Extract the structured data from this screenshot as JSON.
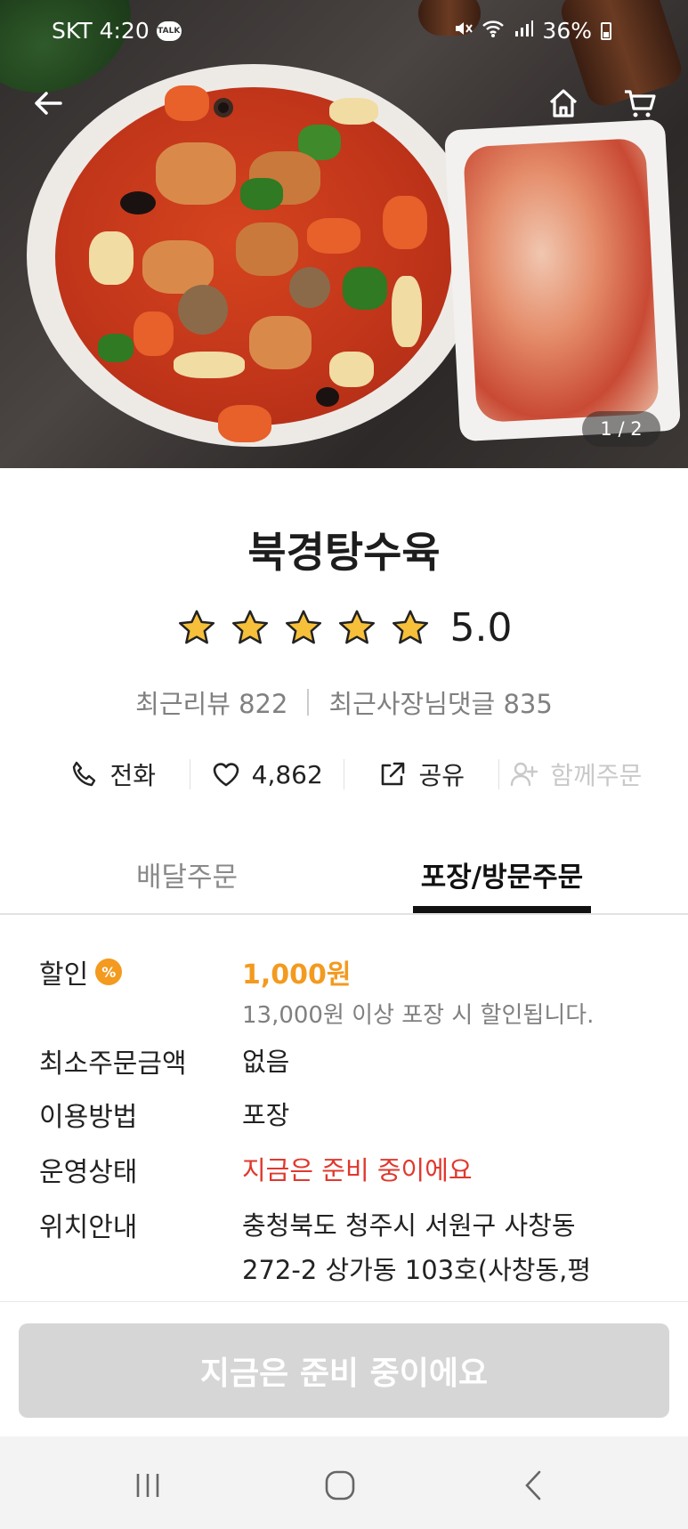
{
  "status_bar": {
    "carrier": "SKT",
    "time": "4:20",
    "talk_badge": "TALK",
    "battery": "36%"
  },
  "hero": {
    "page_indicator": "1 / 2"
  },
  "store": {
    "name": "북경탕수육",
    "rating_value": "5.0",
    "stars": 5,
    "recent_reviews_label": "최근리뷰 822",
    "owner_replies_label": "최근사장님댓글 835"
  },
  "actions": {
    "call": "전화",
    "like_count": "4,862",
    "share": "공유",
    "group_order": "함께주문"
  },
  "tabs": {
    "delivery": "배달주문",
    "pickup": "포장/방문주문"
  },
  "info": {
    "discount_label": "할인",
    "discount_badge": "%",
    "discount_amount": "1,000원",
    "discount_note": "13,000원 이상 포장 시 할인됩니다.",
    "min_order_label": "최소주문금액",
    "min_order_value": "없음",
    "method_label": "이용방법",
    "method_value": "포장",
    "status_label": "운영상태",
    "status_value": "지금은 준비 중이에요",
    "location_label": "위치안내",
    "location_line1": "충청북도 청주시 서원구 사창동",
    "location_line2": "272-2 상가동 103호(사창동,평"
  },
  "cta": {
    "label": "지금은 준비 중이에요"
  },
  "colors": {
    "accent_orange": "#f39a1f",
    "status_red": "#e0382e",
    "cta_disabled": "#d6d6d6"
  }
}
